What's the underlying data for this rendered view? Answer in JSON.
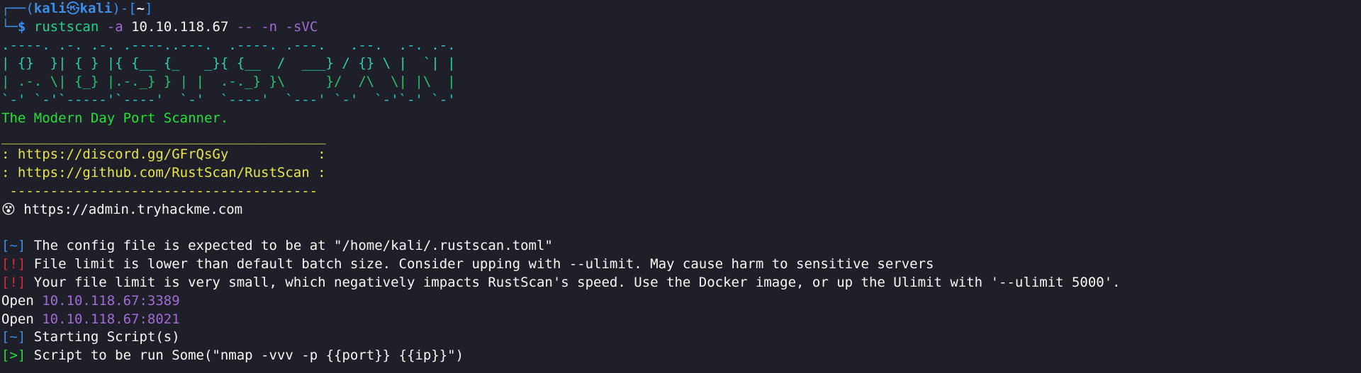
{
  "prompt": {
    "box_top": "┌──(",
    "user": "kali",
    "at": "㉿",
    "host": "kali",
    "mid": ")-[",
    "dir": "~",
    "end": "]",
    "box_bottom": "└─",
    "dollar": "$"
  },
  "command": {
    "program": "rustscan",
    "flag_a": "-a",
    "ip": "10.10.118.67",
    "sep": "--",
    "flag_n": "-n",
    "flag_svc": "-sVC"
  },
  "banner": {
    "art": [
      ".----. .-. .-. .----..---.  .----. .---.   .--.  .-. .-.",
      "| {}  }| { } |{ {__ {_   _}{ {__  /  ___} / {} \\ |  `| |",
      "| .-. \\| {_} |.-._} } | |  .-._} }\\     }/  /\\  \\| |\\  |",
      "`-' `-'`-----'`----'  `-'  `----'  `---' `-'  `-'`-' `-'"
    ],
    "tagline": "The Modern Day Port Scanner."
  },
  "links_box": {
    "top_rule": "________________________________________",
    "discord": ": https://discord.gg/GFrQsGy           :",
    "github": ": https://github.com/RustScan/RustScan :",
    "bottom_rule": " --------------------------------------"
  },
  "quote": {
    "icon": "dizzy-face-icon",
    "text": " https://admin.tryhackme.com"
  },
  "logs": [
    {
      "tag": "[~]",
      "tag_color": "blue",
      "text": " The config file is expected to be at \"/home/kali/.rustscan.toml\""
    },
    {
      "tag": "[!]",
      "tag_color": "red",
      "text": " File limit is lower than default batch size. Consider upping with --ulimit. May cause harm to sensitive servers"
    },
    {
      "tag": "[!]",
      "tag_color": "red",
      "text": " Your file limit is very small, which negatively impacts RustScan's speed. Use the Docker image, or up the Ulimit with '--ulimit 5000'."
    }
  ],
  "open_ports": [
    {
      "label": "Open ",
      "addr": "10.10.118.67:3389"
    },
    {
      "label": "Open ",
      "addr": "10.10.118.67:8021"
    }
  ],
  "script_logs": [
    {
      "tag": "[~]",
      "tag_color": "blue",
      "text": " Starting Script(s)"
    },
    {
      "tag": "[>]",
      "tag_color": "green",
      "text": " Script to be run Some(\"nmap -vvv -p {{port}} {{ip}}\")"
    }
  ]
}
